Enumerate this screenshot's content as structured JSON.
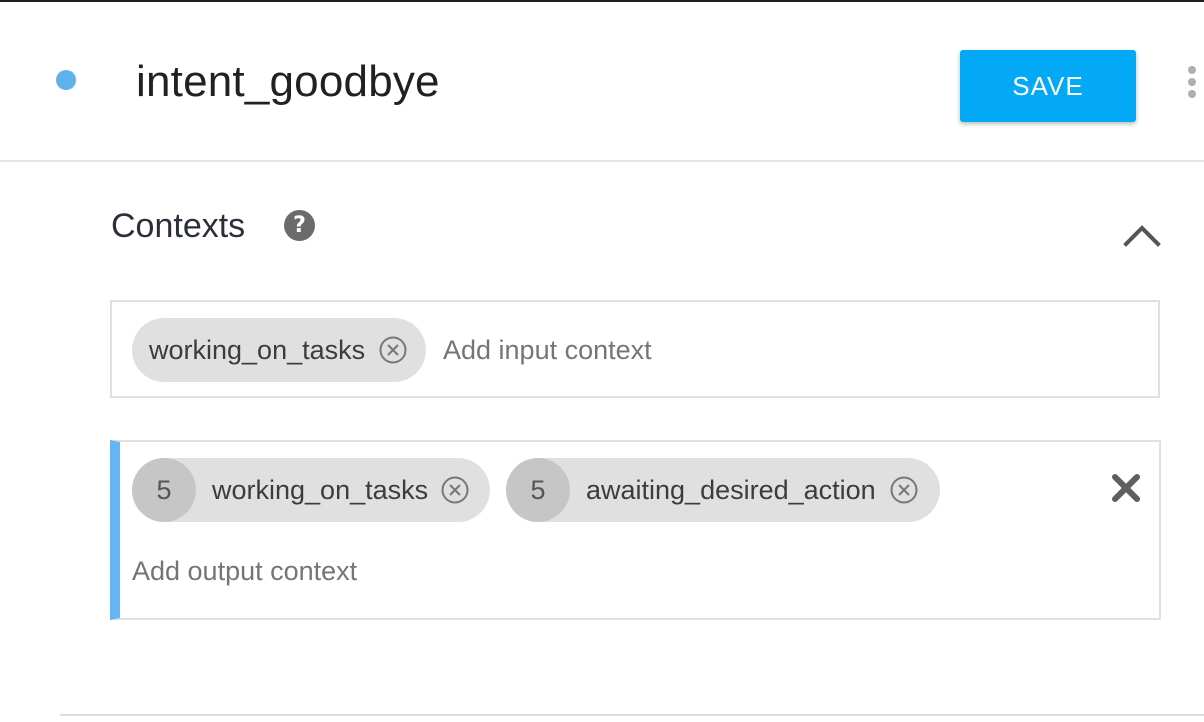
{
  "header": {
    "intent_name": "intent_goodbye",
    "save_label": "SAVE"
  },
  "contexts": {
    "title": "Contexts",
    "input": {
      "chips": [
        {
          "label": "working_on_tasks"
        }
      ],
      "placeholder": "Add input context"
    },
    "output": {
      "chips": [
        {
          "lifespan": "5",
          "label": "working_on_tasks"
        },
        {
          "lifespan": "5",
          "label": "awaiting_desired_action"
        }
      ],
      "placeholder": "Add output context"
    }
  },
  "icons": {
    "status": "dot-icon",
    "help": "help-circle-icon",
    "collapse": "chevron-up-icon",
    "chip_remove": "close-circle-icon",
    "delete": "close-icon",
    "more": "more-vertical-icon"
  },
  "colors": {
    "accent": "#03a9f4",
    "status_dot": "#5eb3ea",
    "output_border": "#64b5f6",
    "chip_bg": "#e0e0e0",
    "chip_count_bg": "#c6c6c6"
  }
}
